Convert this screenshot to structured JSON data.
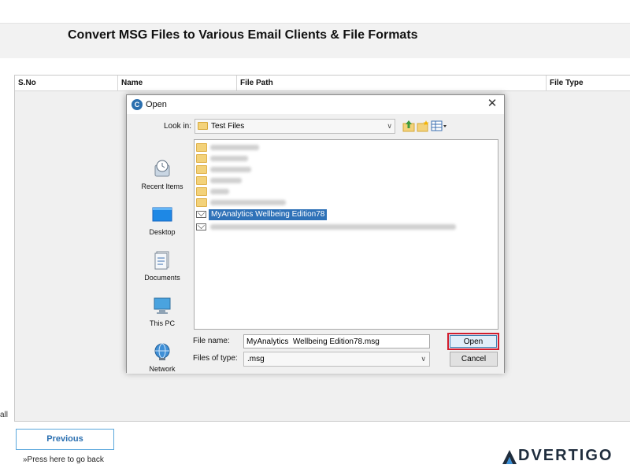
{
  "app": {
    "title": "Convert MSG Files to Various Email Clients & File Formats"
  },
  "table": {
    "columns": [
      "S.No",
      "Name",
      "File Path",
      "File Type"
    ],
    "left_partial_text": "all"
  },
  "navigation": {
    "previous_label": "Previous",
    "hint": "»Press here to go back"
  },
  "dialog": {
    "title": "Open",
    "close_glyph": "✕",
    "look_in_label": "Look in:",
    "look_in_value": "Test Files",
    "places": [
      {
        "label": "Recent Items",
        "icon": "recent-items-icon"
      },
      {
        "label": "Desktop",
        "icon": "desktop-icon"
      },
      {
        "label": "Documents",
        "icon": "documents-icon"
      },
      {
        "label": "This PC",
        "icon": "this-pc-icon"
      },
      {
        "label": "Network",
        "icon": "network-icon"
      }
    ],
    "selected_file": "MyAnalytics  Wellbeing Edition78",
    "file_name_label": "File name:",
    "file_name_value": "MyAnalytics  Wellbeing Edition78.msg",
    "file_type_label": "Files of type:",
    "file_type_value": ".msg",
    "open_label": "Open",
    "cancel_label": "Cancel"
  },
  "watermark": {
    "text": "DVERTIGO",
    "colors": {
      "text": "#1f2d3d",
      "chevron": "#3a8fd6"
    }
  },
  "colors": {
    "selection": "#2f72b8",
    "open_highlight": "#d21d2d",
    "previous_border": "#5aa7dc"
  }
}
